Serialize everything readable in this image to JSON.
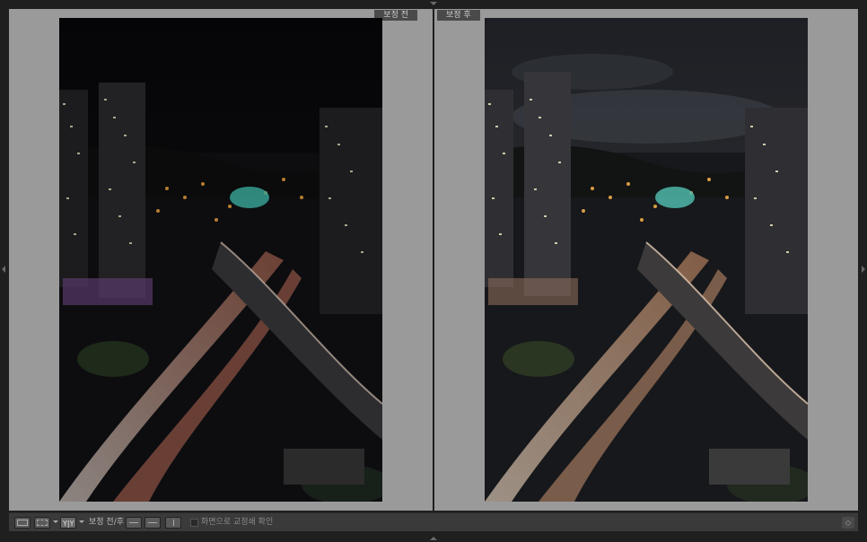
{
  "panes": {
    "before": {
      "label": "보정 전"
    },
    "after": {
      "label": "보정 후"
    }
  },
  "toolbar": {
    "view_compare_label": "Y|Y",
    "before_after_label": "보정 전/후 :",
    "show_on_screen_label": "화면으로 교정쇄 확인"
  },
  "icons": {
    "loupe": "single-view-icon",
    "grid": "grid-view-icon",
    "compare": "before-after-icon",
    "copy_before_to_after": "copy-settings-icon",
    "copy_after_to_before": "copy-settings-reverse-icon",
    "swap": "swap-icon"
  },
  "colors": {
    "background": "#1f1f1f",
    "pane": "#9a9a9a",
    "label_bg": "#4a4a4a",
    "toolbar": "#3a3a3a"
  }
}
